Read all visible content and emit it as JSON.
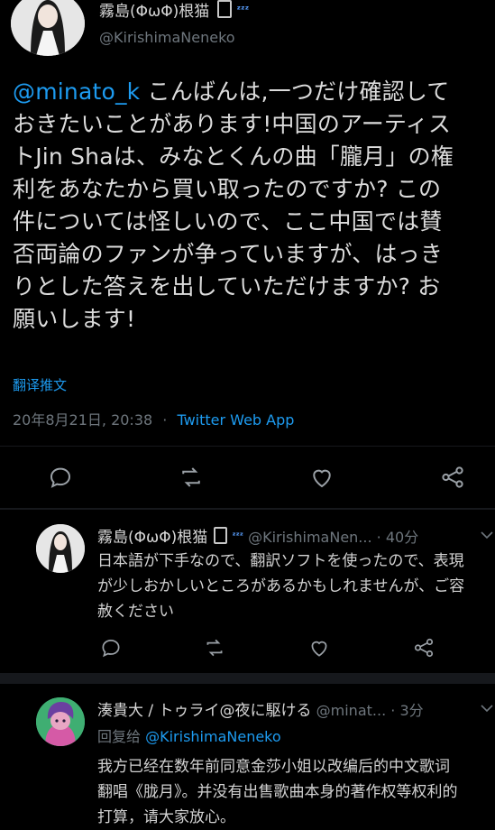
{
  "main_tweet": {
    "display_name": "霧島(ΦωΦ)根猫",
    "handle": "@KirishimaNeneko",
    "mention": "@minato_k",
    "body_lines": [
      "こんばんは,一つだけ確認して",
      "おきたいことがあります!中国のアーティス",
      "トJin Shaは、みなとくんの曲「朧月」の権",
      "利をあなたから買い取ったのですか? この",
      "件については怪しいので、ここ中国では賛",
      "否両論のファンが争っていますが、はっき",
      "りとした答えを出していただけますか? お",
      "願いします!"
    ],
    "translate_label": "翻译推文",
    "timestamp": "20年8月21日, 20:38",
    "separator": "·",
    "source": "Twitter Web App"
  },
  "reply1": {
    "display_name": "霧島(ΦωΦ)根猫",
    "handle": "@KirishimaNen...",
    "separator": "·",
    "time": "40分",
    "lines": [
      "日本語が下手なので、翻訳ソフトを使ったので、表現",
      "が少しおかしいところがあるかもしれませんが、ご容",
      "赦ください"
    ]
  },
  "reply2": {
    "display_name": "湊貴大 / トゥライ@夜に駆ける",
    "handle": "@minat...",
    "separator": "·",
    "time": "3分",
    "reply_prefix": "回复给",
    "reply_to": "@KirishimaNeneko",
    "lines": [
      "我方已经在数年前同意金莎小姐以改编后的中文歌词",
      "翻唱《胧月》。并没有出售歌曲本身的著作权等权利的",
      "打算，请大家放心。"
    ]
  },
  "icons": {
    "status_icon_1": "phone-icon",
    "status_icon_2": "zzz-icon",
    "reply": "reply-icon",
    "retweet": "retweet-icon",
    "like": "heart-icon",
    "share": "share-icon",
    "more": "chevron-down-icon"
  },
  "colors": {
    "background": "#000000",
    "link": "#1d9bf0",
    "muted": "#6e767d",
    "text": "#dcdcdc"
  }
}
